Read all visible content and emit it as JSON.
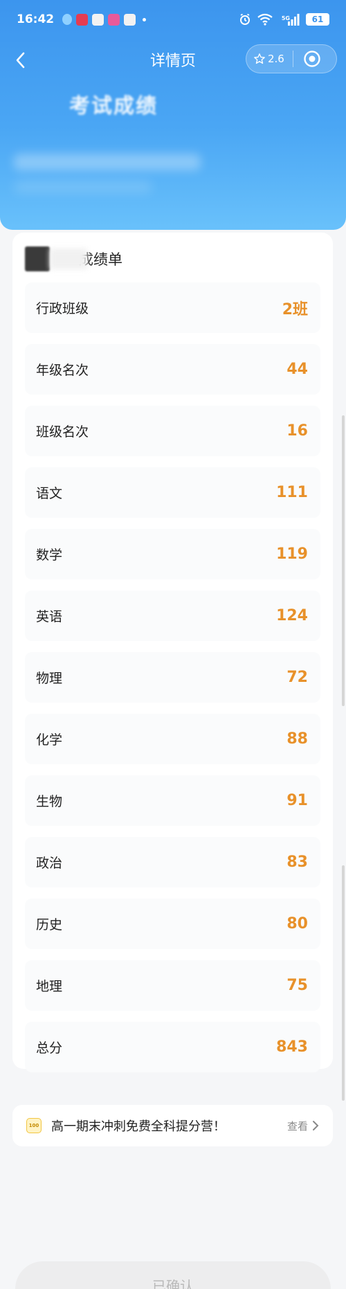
{
  "status_bar": {
    "time": "16:42",
    "network": "5G",
    "battery": "61"
  },
  "nav": {
    "title": "详情页",
    "rating": "2.6"
  },
  "header": {
    "exam_heading": "考试成绩"
  },
  "card": {
    "title": "成绩单",
    "rows": [
      {
        "label": "行政班级",
        "value": "2班"
      },
      {
        "label": "年级名次",
        "value": "44"
      },
      {
        "label": "班级名次",
        "value": "16"
      },
      {
        "label": "语文",
        "value": "111"
      },
      {
        "label": "数学",
        "value": "119"
      },
      {
        "label": "英语",
        "value": "124"
      },
      {
        "label": "物理",
        "value": "72"
      },
      {
        "label": "化学",
        "value": "88"
      },
      {
        "label": "生物",
        "value": "91"
      },
      {
        "label": "政治",
        "value": "83"
      },
      {
        "label": "历史",
        "value": "80"
      },
      {
        "label": "地理",
        "value": "75"
      },
      {
        "label": "总分",
        "value": "843"
      }
    ]
  },
  "promo": {
    "text": "高一期末冲刺免费全科提分营！",
    "more": "查看"
  },
  "confirm": {
    "label": "已确认"
  },
  "colors": {
    "header_blue": "#3c95ee",
    "value_orange": "#e8912a"
  },
  "icons": [
    "back-arrow-icon",
    "star-icon",
    "target-icon",
    "chevron-right-icon",
    "wifi-icon",
    "signal-icon",
    "alarm-icon",
    "battery-icon"
  ]
}
